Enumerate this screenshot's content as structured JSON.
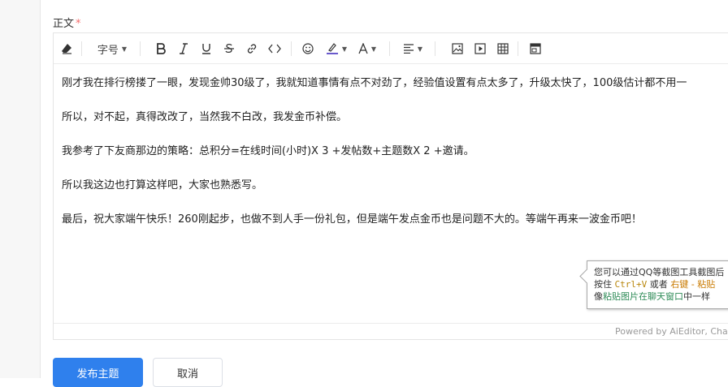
{
  "form": {
    "body_label": "正文",
    "required_mark": "*"
  },
  "toolbar": {
    "font_size_label": "字号",
    "items": [
      "eraser-icon",
      "font-size",
      "bold-icon",
      "italic-icon",
      "underline-icon",
      "strikethrough-icon",
      "link-icon",
      "code-icon",
      "emoji-icon",
      "highlight-icon",
      "font-color-icon",
      "align-icon",
      "image-icon",
      "video-icon",
      "table-icon",
      "source-icon"
    ]
  },
  "content": {
    "paragraphs": [
      "刚才我在排行榜搂了一眼，发现金帅30级了，我就知道事情有点不对劲了，经验值设置有点太多了，升级太快了，100级估计都不用一",
      "所以，对不起，真得改改了，当然我不白改，我发金币补偿。",
      "我参考了下友商那边的策略：总积分=在线时间(小时)X 3 +发帖数+主题数X 2 +邀请。",
      "所以我这边也打算这样吧，大家也熟悉写。",
      "最后，祝大家端午快乐！260刚起步，也做不到人手一份礼包，但是端午发点金币也是问题不大的。等端午再来一波金币吧！"
    ]
  },
  "tooltip": {
    "line1": "您可以通过QQ等截图工具截图后",
    "line2_a": "按住",
    "line2_key": "Ctrl+V",
    "line2_b": "或者",
    "line2_key2": "右键 - 粘贴",
    "line3_a": "像",
    "line3_green": "粘贴图片在聊天窗口",
    "line3_b": "中一样"
  },
  "footer": {
    "powered_by": "Powered by AiEditor, Char"
  },
  "actions": {
    "publish_label": "发布主题",
    "cancel_label": "取消"
  },
  "colors": {
    "primary": "#2f80ed",
    "required": "#f56c6c",
    "highlight_underline": "#6a5acd"
  }
}
